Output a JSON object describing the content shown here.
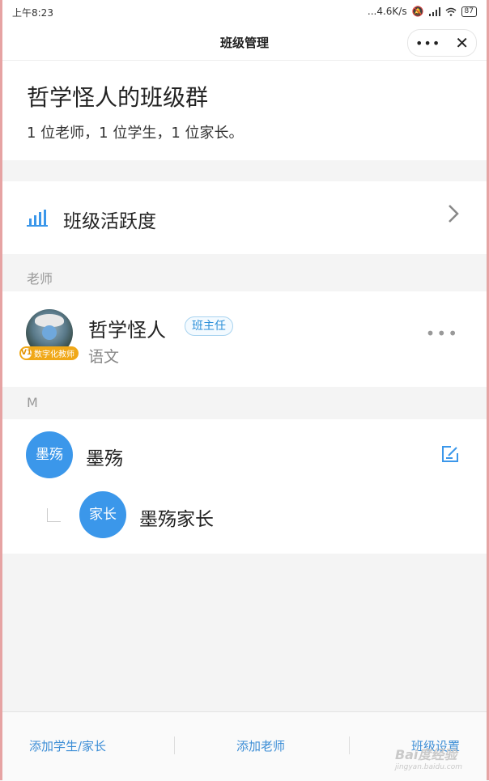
{
  "status_bar": {
    "time": "上午8:23",
    "network": "...4.6K/s",
    "battery": "87"
  },
  "navbar": {
    "title": "班级管理",
    "more_label": "•••",
    "close_label": "✕"
  },
  "class_info": {
    "name": "哲学怪人的班级群",
    "summary": "1 位老师，1 位学生，1 位家长。"
  },
  "activity": {
    "label": "班级活跃度"
  },
  "teachers_section": {
    "heading": "老师",
    "items": [
      {
        "name": "哲学怪人",
        "role_badge": "班主任",
        "subject": "语文",
        "vip_level": "V1",
        "vip_label": "数字化教师",
        "more": "•••"
      }
    ]
  },
  "students_section": {
    "heading": "M",
    "items": [
      {
        "avatar_text": "墨殇",
        "name": "墨殇",
        "parent": {
          "avatar_text": "家长",
          "name": "墨殇家长"
        }
      }
    ]
  },
  "bottom_bar": {
    "add_student": "添加学生/家长",
    "add_teacher": "添加老师",
    "class_settings": "班级设置"
  },
  "watermark": {
    "text": "Bai度经验",
    "sub": "jingyan.baidu.com"
  },
  "colors": {
    "accent": "#3b97ea",
    "link": "#3d8ed6",
    "vip": "#f0a818"
  }
}
